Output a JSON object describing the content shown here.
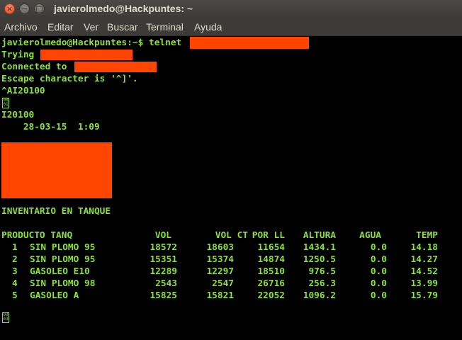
{
  "window": {
    "title": "javierolmedo@Hackpuntes: ~"
  },
  "menubar": {
    "items": [
      "Archivo",
      "Editar",
      "Ver",
      "Buscar",
      "Terminal",
      "Ayuda"
    ]
  },
  "terminal": {
    "colors": {
      "text": "#8ae234",
      "background": "#000000",
      "redaction": "#ff4500"
    },
    "prompt": "javierolmedo@Hackpuntes:~$ telnet",
    "trying": "Trying",
    "connected": "Connected to",
    "escape": "Escape character is '^]'.",
    "command": "^AI20100",
    "ctrl_char_1": [
      "00",
      "01"
    ],
    "response_code": "I20100",
    "datetime": "    28-03-15  1:09",
    "section_title": "INVENTARIO EN TANQUE",
    "ctrl_char_2": [
      "00",
      "03"
    ],
    "table": {
      "headers": [
        "PRODUCTO TANQ",
        "VOL",
        "VOL CT",
        "POR LL",
        "ALTURA",
        "AGUA",
        "TEMP"
      ],
      "rows": [
        {
          "n": "1",
          "producto": "SIN PLOMO 95",
          "vol": "18572",
          "vol_ct": "18603",
          "por_ll": "11654",
          "altura": "1434.1",
          "agua": "0.0",
          "temp": "14.18"
        },
        {
          "n": "2",
          "producto": "SIN PLOMO 95",
          "vol": "15351",
          "vol_ct": "15374",
          "por_ll": "14874",
          "altura": "1250.5",
          "agua": "0.0",
          "temp": "14.27"
        },
        {
          "n": "3",
          "producto": "GASOLEO E10",
          "vol": "12289",
          "vol_ct": "12297",
          "por_ll": "18510",
          "altura": "976.5",
          "agua": "0.0",
          "temp": "14.52"
        },
        {
          "n": "4",
          "producto": "SIN PLOMO 98",
          "vol": "2543",
          "vol_ct": "2547",
          "por_ll": "26716",
          "altura": "256.3",
          "agua": "0.0",
          "temp": "13.99"
        },
        {
          "n": "5",
          "producto": "GASOLEO A",
          "vol": "15825",
          "vol_ct": "15821",
          "por_ll": "22052",
          "altura": "1096.2",
          "agua": "0.0",
          "temp": "15.79"
        }
      ]
    }
  }
}
